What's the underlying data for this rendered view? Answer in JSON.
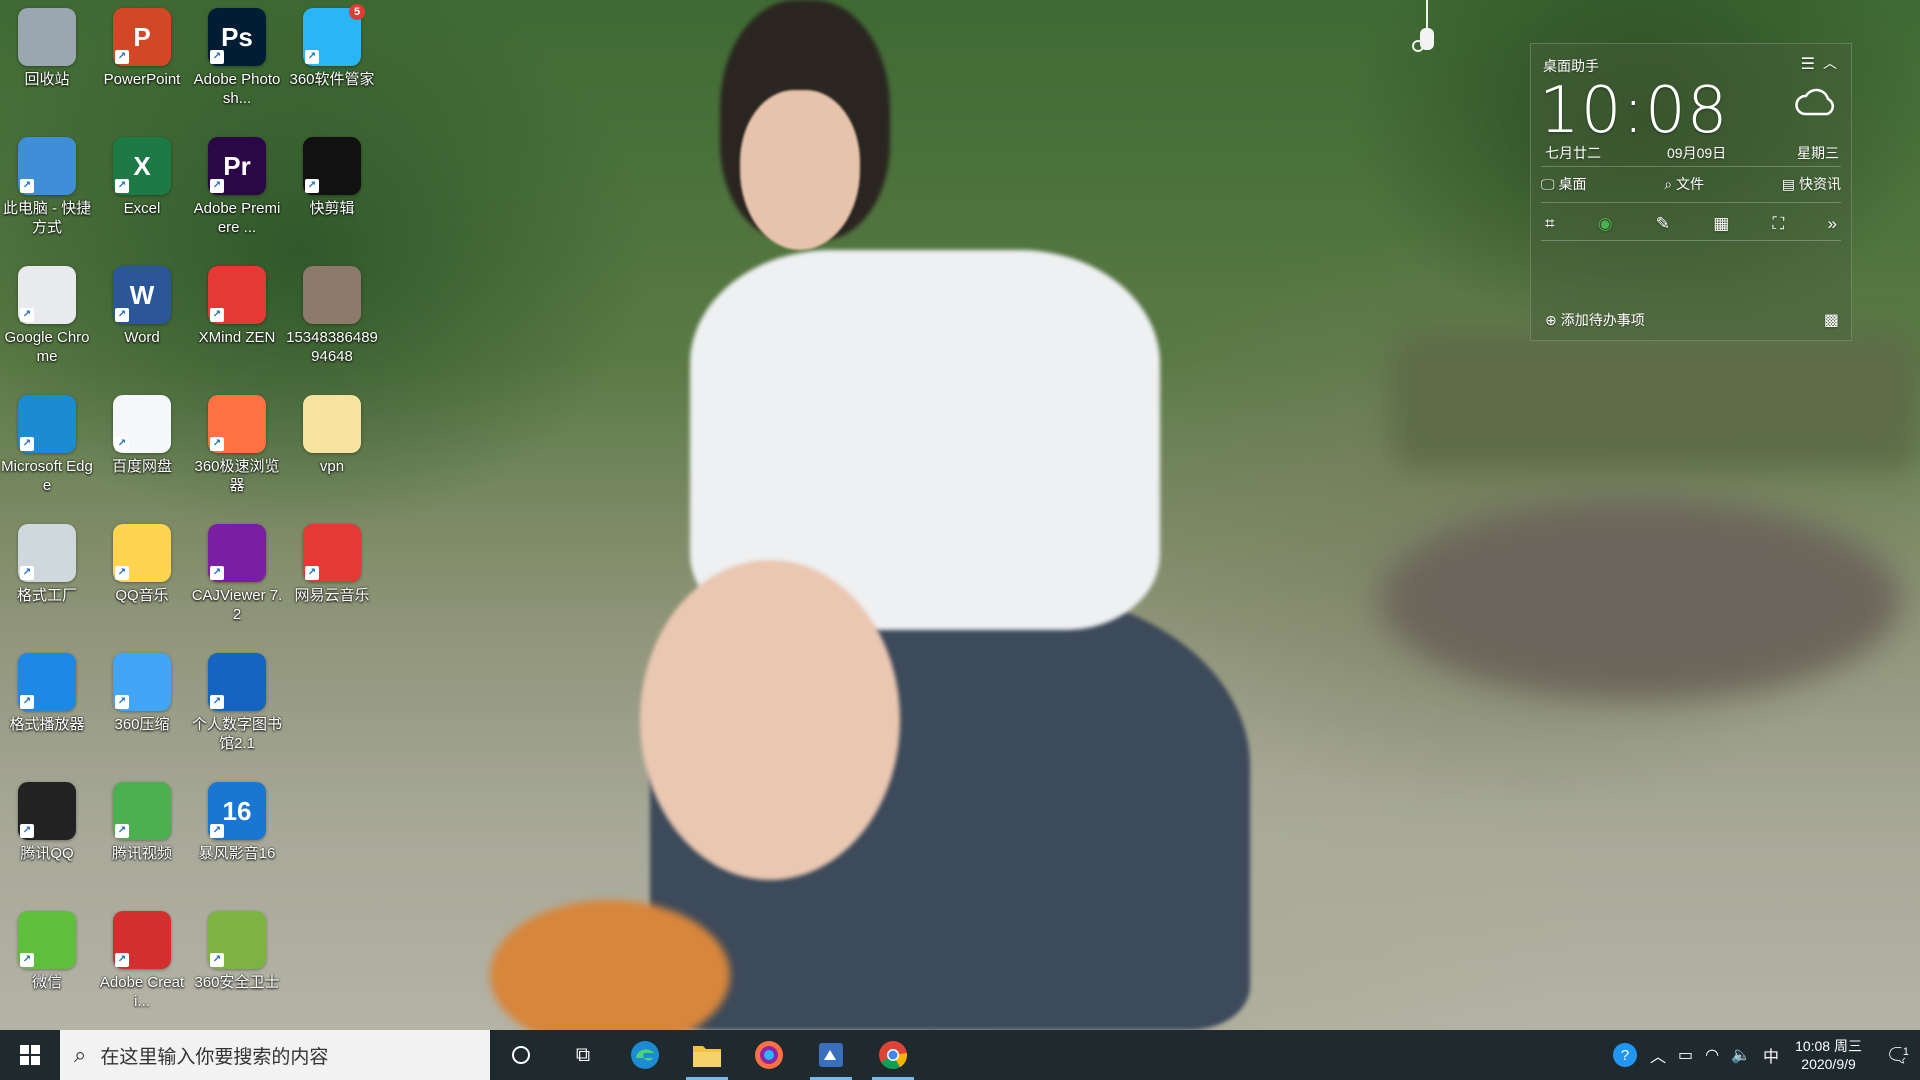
{
  "desktop_icons": [
    {
      "label": "回收站",
      "icon": "recycle-bin-icon",
      "color": "#9aa7b1"
    },
    {
      "label": "PowerPoint",
      "icon": "powerpoint-icon",
      "color": "#d24726",
      "glyph": "P"
    },
    {
      "label": "Adobe Photosh...",
      "icon": "photoshop-icon",
      "color": "#001d34",
      "glyph": "Ps"
    },
    {
      "label": "360软件管家",
      "icon": "software-manager-icon",
      "color": "#29b6f6",
      "badge": "5"
    },
    {
      "label": "此电脑 - 快捷方式",
      "icon": "this-pc-icon",
      "color": "#3f8fd8"
    },
    {
      "label": "Excel",
      "icon": "excel-icon",
      "color": "#1d7a45",
      "glyph": "X"
    },
    {
      "label": "Adobe Premiere ...",
      "icon": "premiere-icon",
      "color": "#2a0845",
      "glyph": "Pr"
    },
    {
      "label": "快剪辑",
      "icon": "kuaijianji-icon",
      "color": "#111111"
    },
    {
      "label": "Google Chrome",
      "icon": "chrome-icon",
      "color": "#e8eaed"
    },
    {
      "label": "Word",
      "icon": "word-icon",
      "color": "#2b579a",
      "glyph": "W"
    },
    {
      "label": "XMind ZEN",
      "icon": "xmind-icon",
      "color": "#e53935"
    },
    {
      "label": "1534838648994648",
      "icon": "photo-file-icon",
      "color": "#8d7a6a"
    },
    {
      "label": "Microsoft Edge",
      "icon": "edge-icon",
      "color": "#1b8bd3"
    },
    {
      "label": "百度网盘",
      "icon": "baidu-netdisk-icon",
      "color": "#f5f7fa"
    },
    {
      "label": "360极速浏览器",
      "icon": "360-browser-icon",
      "color": "#ff7043"
    },
    {
      "label": "vpn",
      "icon": "folder-icon",
      "color": "#f6e3a0"
    },
    {
      "label": "格式工厂",
      "icon": "format-factory-icon",
      "color": "#cfd8dc"
    },
    {
      "label": "QQ音乐",
      "icon": "qq-music-icon",
      "color": "#ffd54f"
    },
    {
      "label": "CAJViewer 7.2",
      "icon": "cajviewer-icon",
      "color": "#7b1fa2"
    },
    {
      "label": "网易云音乐",
      "icon": "netease-music-icon",
      "color": "#e53935"
    },
    {
      "label": "格式播放器",
      "icon": "format-player-icon",
      "color": "#1e88e5"
    },
    {
      "label": "360压缩",
      "icon": "360-zip-icon",
      "color": "#42a5f5"
    },
    {
      "label": "个人数字图书馆2.1",
      "icon": "digital-library-icon",
      "color": "#1565c0"
    },
    {
      "label": "腾讯QQ",
      "icon": "qq-icon",
      "color": "#222222"
    },
    {
      "label": "腾讯视频",
      "icon": "tencent-video-icon",
      "color": "#4caf50"
    },
    {
      "label": "暴风影音16",
      "icon": "baofeng-icon",
      "color": "#1976d2",
      "glyph": "16"
    },
    {
      "label": "微信",
      "icon": "wechat-icon",
      "color": "#5fbf3d"
    },
    {
      "label": "Adobe Creati...",
      "icon": "creative-cloud-icon",
      "color": "#d32f2f"
    },
    {
      "label": "360安全卫士",
      "icon": "360-security-icon",
      "color": "#7cb342"
    }
  ],
  "widget": {
    "title": "桌面助手",
    "time": "10:08",
    "lunar_date": "七月廿二",
    "date": "09月09日",
    "weekday": "星期三",
    "tabs": [
      "桌面",
      "文件",
      "快资讯"
    ],
    "add_todo": "添加待办事项"
  },
  "taskbar": {
    "search_placeholder": "在这里输入你要搜索的内容",
    "ime": "中",
    "clock_time": "10:08 周三",
    "clock_date": "2020/9/9",
    "notification_count": "1",
    "accent": "#76b9ed"
  }
}
